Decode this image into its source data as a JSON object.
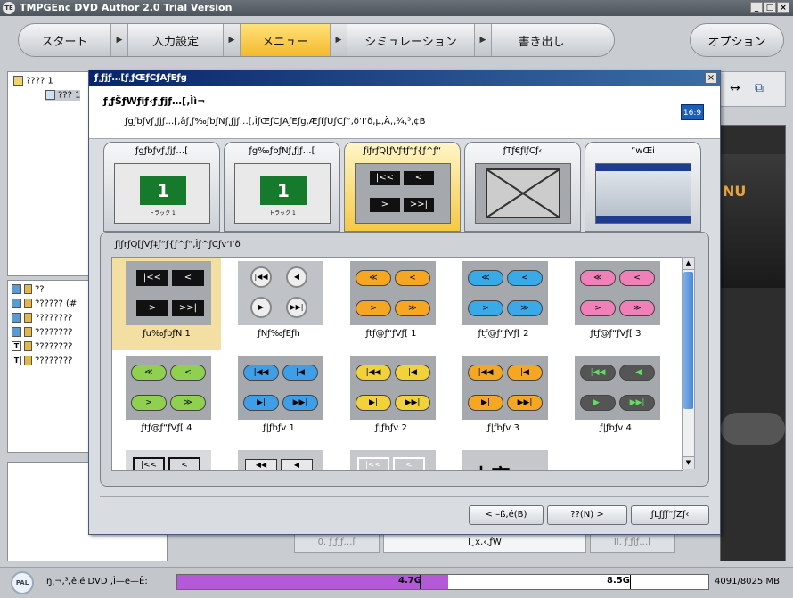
{
  "app": {
    "title": "TMPGEnc DVD Author 2.0 Trial Version",
    "logo_text": "TE"
  },
  "window_buttons": {
    "minimize": "_",
    "maximize": "□",
    "close": "×"
  },
  "nav": {
    "steps": [
      {
        "label": "スタート"
      },
      {
        "label": "入力設定"
      },
      {
        "label": "メニュー"
      },
      {
        "label": "シミュレーション"
      },
      {
        "label": "書き出し"
      }
    ],
    "arrow": "▶",
    "options_label": "オプション"
  },
  "left_tree": {
    "items": [
      "???? 1",
      "??? 1"
    ],
    "list": [
      "??",
      "?????? (#",
      "????????",
      "????????",
      "????????",
      "????????"
    ]
  },
  "right_panel": {
    "toolbar_glyphs": [
      "↔",
      "⧉"
    ],
    "preview_text": "NU"
  },
  "dialog": {
    "title": "ƒ͵ƒjƒ…[ƒ͵ƒŒƒCƒAƒEƒg",
    "close": "×",
    "heading": "ƒ͵ƒŠƒWƒiƒ‹ƒ͵ƒjƒ…[‚Ìì¬",
    "description": "ƒgƒbƒvƒ͵ƒjƒ…[‚âƒ͵ƒ‰ƒbƒNƒ͵ƒjƒ…[‚ÌƒŒƒCƒAƒEƒg‚ÆƒfƒUƒCƒ“‚ð‘I‘ð‚µ‚Ä‚­‚¾‚³‚¢B",
    "aspect_badge": "16:9",
    "tabs": [
      {
        "label": "ƒgƒbƒvƒ͵ƒjƒ…["
      },
      {
        "label": "ƒg‰ƒbƒNƒ͵ƒjƒ…["
      },
      {
        "label": "ƒiƒrƒQ[ƒVƒ‡ƒ“ƒ{ƒ^ƒ“"
      },
      {
        "label": "ƒTƒ€ƒlƒCƒ‹"
      },
      {
        "label": "”wŒi"
      }
    ],
    "thumb_number": "1",
    "thumb_caption": "トラック 1",
    "panel_title": "ƒiƒrƒQ[ƒVƒ‡ƒ“ƒ{ƒ^ƒ“‚Ìƒ^ƒCƒv‘I‘ð",
    "styles": [
      {
        "label": "ƒu‰ƒbƒN 1"
      },
      {
        "label": "ƒNƒ‰ƒEƒh"
      },
      {
        "label": "ƒtƒ@ƒ“ƒVƒ[ 1"
      },
      {
        "label": "ƒtƒ@ƒ“ƒVƒ[ 2"
      },
      {
        "label": "ƒtƒ@ƒ“ƒVƒ[ 3"
      },
      {
        "label": "ƒtƒ@ƒ“ƒVƒ[ 4"
      },
      {
        "label": "ƒ|ƒbƒv 1"
      },
      {
        "label": "ƒ|ƒbƒv 2"
      },
      {
        "label": "ƒ|ƒbƒv 3"
      },
      {
        "label": "ƒ|ƒbƒv 4"
      }
    ],
    "partial_glyph": "木宮",
    "buttons": {
      "back": "< –ß‚é(B)",
      "next": "??(N) >",
      "cancel": "ƒLƒƒƒ“ƒZƒ‹"
    }
  },
  "lower_tabs": [
    "0. ƒ͵ƒjƒ…[",
    "Ì¸x,‹.ƒW",
    "II. ƒ͵ƒjƒ…["
  ],
  "status": {
    "disc_label": "PAL",
    "text": "ŋ͵¬‚³‚ê‚é DVD ‚Ì—e—Ê:",
    "mark1": "4.7G",
    "mark2": "8.5G",
    "usage": "4091/8025 MB",
    "fill_fraction": 0.51
  }
}
